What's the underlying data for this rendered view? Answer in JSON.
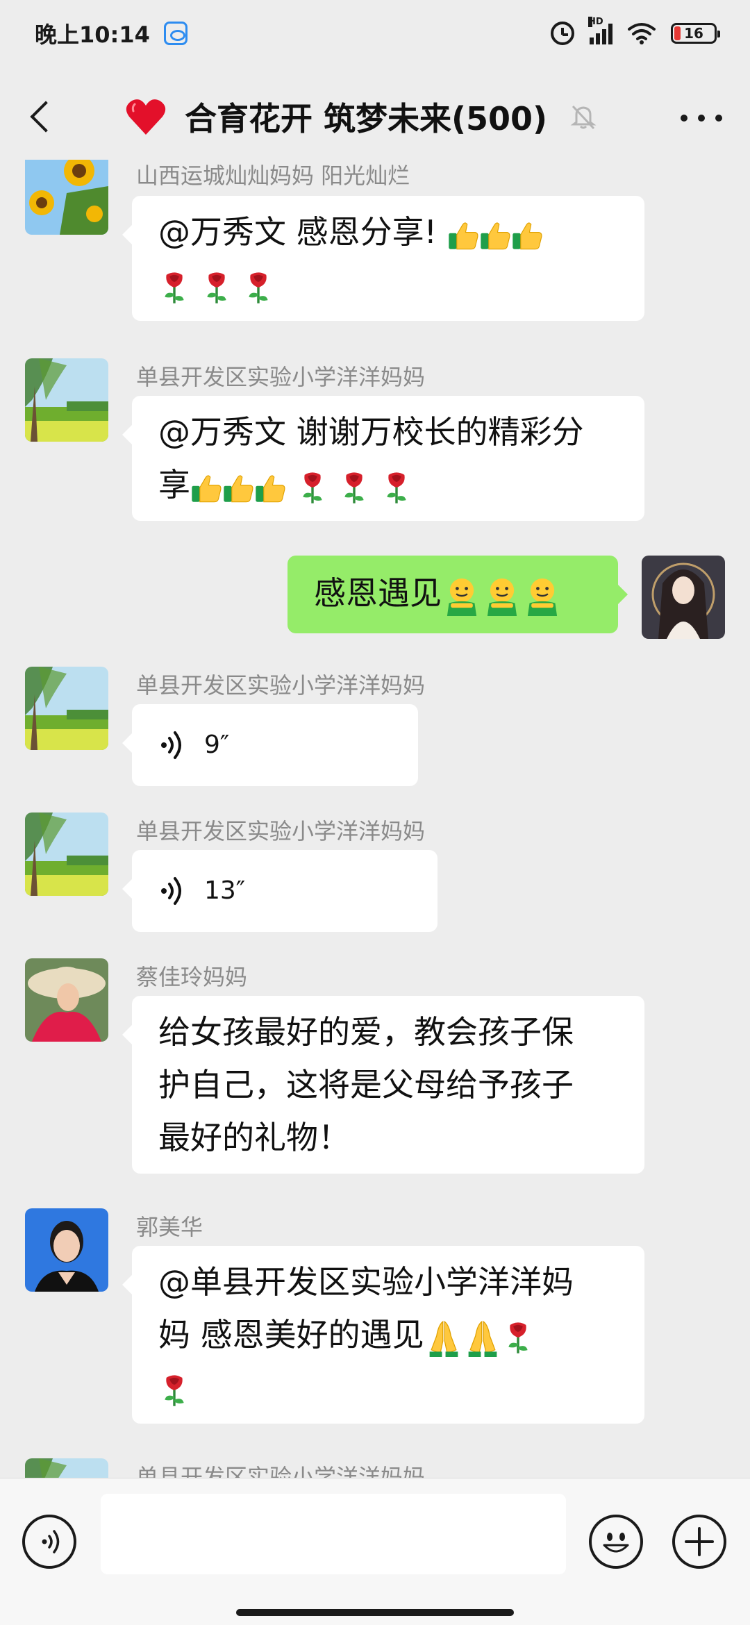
{
  "status_bar": {
    "time": "晚上10:14",
    "network_label": "HD",
    "battery_level": "16"
  },
  "header": {
    "title": "合育花开 筑梦未来(500)",
    "icons": [
      "back-arrow-icon",
      "heart-icon",
      "mute-bell-icon",
      "more-icon"
    ]
  },
  "messages": [
    {
      "sender": "山西运城灿灿妈妈 阳光灿烂",
      "avatar": "sunflower",
      "text": "@万秀文  感恩分享!",
      "emoji_after": [
        "thumbs-up",
        "thumbs-up",
        "thumbs-up",
        "rose",
        "rose",
        "rose"
      ]
    },
    {
      "sender": "单县开发区实验小学洋洋妈妈",
      "avatar": "tree-landscape",
      "text": "@万秀文  谢谢万校长的精彩分享",
      "emoji_after": [
        "thumbs-up",
        "thumbs-up",
        "thumbs-up",
        "rose",
        "rose",
        "rose"
      ]
    },
    {
      "sender": "",
      "avatar": "self-portrait",
      "is_self": true,
      "text": "感恩遇见",
      "emoji_after": [
        "hugging-face",
        "hugging-face",
        "hugging-face"
      ]
    },
    {
      "sender": "单县开发区实验小学洋洋妈妈",
      "avatar": "tree-landscape",
      "voice_duration": "9″"
    },
    {
      "sender": "单县开发区实验小学洋洋妈妈",
      "avatar": "tree-landscape",
      "voice_duration": "13″"
    },
    {
      "sender": "蔡佳玲妈妈",
      "avatar": "woman-straw-hat",
      "text_lines": [
        "给女孩最好的爱，教会孩子保",
        "护自己，这将是父母给予孩子",
        "最好的礼物！"
      ]
    },
    {
      "sender": "郭美华",
      "avatar": "woman-blue-background",
      "text": "@单县开发区实验小学洋洋妈妈  感恩美好的遇见",
      "emoji_after": [
        "folded-hands",
        "folded-hands",
        "rose",
        "rose"
      ]
    },
    {
      "sender": "单县开发区实验小学洋洋妈妈",
      "avatar": "tree-landscape",
      "partial": true
    }
  ],
  "msg1": {
    "line1": "@万秀文  感恩分享!"
  },
  "msg2": {
    "line1": "@万秀文  谢谢万校长的精彩分",
    "line2_prefix": "享"
  },
  "msg3": {
    "text": "感恩遇见"
  },
  "msg4": {
    "duration": "9″"
  },
  "msg5": {
    "duration": "13″"
  },
  "msg6": {
    "line1": "给女孩最好的爱，教会孩子保",
    "line2": "护自己，这将是父母给予孩子",
    "line3": "最好的礼物！"
  },
  "msg7": {
    "line1": "@单县开发区实验小学洋洋妈",
    "line2": "妈  感恩美好的遇见"
  },
  "input_bar": {
    "placeholder": "",
    "icons": [
      "voice-input-icon",
      "emoji-icon",
      "plus-icon"
    ]
  },
  "colors": {
    "background": "#ededed",
    "self_bubble": "#95ec69",
    "other_bubble": "#ffffff",
    "sender_name": "#8a8a8a"
  }
}
